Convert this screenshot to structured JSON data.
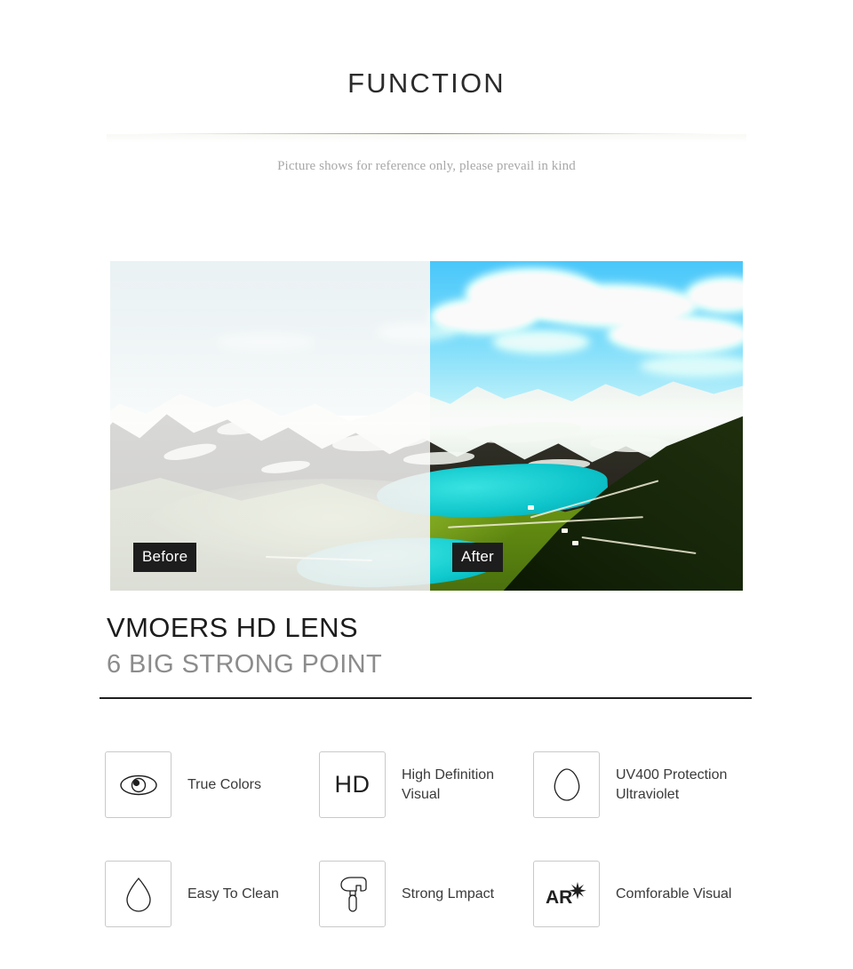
{
  "header": {
    "title": "FUNCTION",
    "subtitle": "Picture shows for reference only, please prevail in kind"
  },
  "comparison": {
    "before_label": "Before",
    "after_label": "After",
    "alt": "mountain-landscape-before-after-lens-comparison"
  },
  "brand": {
    "title": "VMOERS HD LENS",
    "subtitle": "6 BIG STRONG POINT"
  },
  "features": [
    {
      "icon": "eye-icon",
      "label": "True Colors"
    },
    {
      "icon": "hd-icon",
      "label": "High Definition Visual",
      "icon_text": "HD"
    },
    {
      "icon": "shield-icon",
      "label": "UV400 Protection Ultraviolet"
    },
    {
      "icon": "droplet-icon",
      "label": "Easy To Clean"
    },
    {
      "icon": "hammer-icon",
      "label": "Strong Lmpact"
    },
    {
      "icon": "ar-icon",
      "label": "Comforable Visual",
      "icon_text": "AR"
    }
  ],
  "colors": {
    "background": "#ffffff",
    "title": "#2b2b2b",
    "subtitle": "#a8a8a8",
    "brand_title": "#1c1c1c",
    "brand_subtitle": "#8c8c8c",
    "rule": "#1f1f1f",
    "icon_border": "#c9c9c9",
    "label_background": "#1d1d1d",
    "label_text": "#ffffff",
    "divider_accent": "#8c8b60"
  }
}
